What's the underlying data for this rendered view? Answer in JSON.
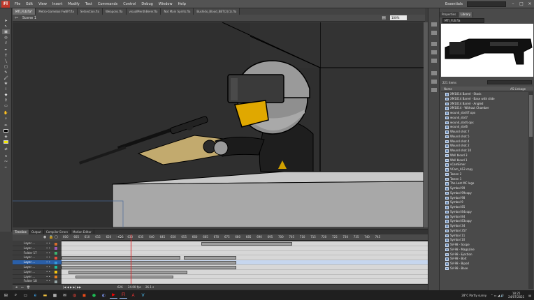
{
  "app": {
    "logo": "Fl",
    "menu": [
      "File",
      "Edit",
      "View",
      "Insert",
      "Modify",
      "Text",
      "Commands",
      "Control",
      "Debug",
      "Window",
      "Help"
    ],
    "workspace": "Essentials"
  },
  "doc_tabs": [
    "MTI_FL6.fla*",
    "Metro-Gameboi FwBFf.fla",
    "Setsection.fla",
    "Weapons.fla",
    "visualMenthBerer.fla",
    "Not Main Spirits.fla",
    "Bushido_Blood_BBT(2)(1).fla"
  ],
  "editbar": {
    "scene": "Scene 1",
    "zoom": "100%"
  },
  "library": {
    "tabs": [
      "Properties",
      "Library"
    ],
    "doc": "MTI_FL6.fla",
    "count": "221 items",
    "columns": {
      "name": "Name",
      "linkage": "AS Linkage"
    },
    "items": [
      "XM1014 Barrel - Stock",
      "XM1014 Barrel - Base with slide",
      "XM1014 Barrel - Angled",
      "XM1014 - Without Chamber",
      "wound_slot47.opx",
      "wound_slot7",
      "wound_slot4.opx",
      "wound_slot6",
      "Wound shot 7",
      "Wound shot 5",
      "Wound shot 4",
      "Wound shot 2",
      "Wound shot 10",
      "Wall blood 3",
      "Wall blood 1",
      "vCamEmer",
      "VCam_AS3 copy",
      "Tween 2",
      "Tween 1",
      "The Lost MC logo",
      "Symbol 99",
      "Symbol 99copy",
      "Symbol 98",
      "Symbol 9",
      "Symbol 85",
      "Symbol 84copy",
      "Symbol 84",
      "Symbol 83copy",
      "Symbol 34",
      "Symbol 357",
      "Symbol 11",
      "Symbol 10",
      "SV-98 - Scope",
      "SV-98 - Magazine",
      "SV-98 - Ejection",
      "SV-98 - Bolt",
      "SV-98 - Bipod",
      "SV-98 - Base"
    ]
  },
  "timeline": {
    "tabs": [
      "Timeline",
      "Output",
      "Compiler Errors",
      "Motion Editor"
    ],
    "frame_numbers": [
      "600",
      "605",
      "610",
      "615",
      "620",
      "625",
      "630",
      "635",
      "640",
      "645",
      "650",
      "655",
      "660",
      "665",
      "670",
      "675",
      "680",
      "685",
      "690",
      "695",
      "700",
      "705",
      "710",
      "715",
      "720",
      "725",
      "730",
      "735",
      "740",
      "745"
    ],
    "current_frame": "626",
    "layers": [
      {
        "name": "Layer ...",
        "selected": false,
        "color": "#d66d2b"
      },
      {
        "name": "Layer ...",
        "selected": false,
        "color": "#9b59b6"
      },
      {
        "name": "Folder 17",
        "selected": false,
        "color": "#3cb371"
      },
      {
        "name": "Layer ...",
        "selected": false,
        "color": "#e74c3c"
      },
      {
        "name": "Layer ...",
        "selected": true,
        "color": "#3498db"
      },
      {
        "name": "Layer ...",
        "selected": false,
        "color": "#1abc9c"
      },
      {
        "name": "Layer ...",
        "selected": false,
        "color": "#f1c40f"
      },
      {
        "name": "Layer ...",
        "selected": false,
        "color": "#e67e22"
      },
      {
        "name": "Folder 18",
        "selected": false,
        "color": "#95a5a6"
      }
    ],
    "footer": {
      "fps": "24.00 fps",
      "time": "26.1 s",
      "frame": "626"
    }
  },
  "taskbar": {
    "weather": "28°C  Partly sunny",
    "time": "18:25",
    "date": "24/07/2021"
  }
}
